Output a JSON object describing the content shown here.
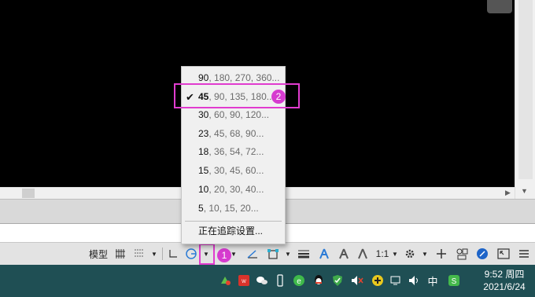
{
  "statusbar": {
    "model_label": "模型",
    "scale_label": "1:1"
  },
  "menu": {
    "items": [
      {
        "first": "90",
        "rest": ", 180, 270, 360...",
        "selected": false
      },
      {
        "first": "45",
        "rest": ", 90, 135, 180...",
        "selected": true
      },
      {
        "first": "30",
        "rest": ", 60, 90, 120...",
        "selected": false
      },
      {
        "first": "23",
        "rest": ", 45, 68, 90...",
        "selected": false
      },
      {
        "first": "18",
        "rest": ", 36, 54, 72...",
        "selected": false
      },
      {
        "first": "15",
        "rest": ", 30, 45, 60...",
        "selected": false
      },
      {
        "first": "10",
        "rest": ", 20, 30, 40...",
        "selected": false
      },
      {
        "first": "5",
        "rest": ", 10, 15, 20...",
        "selected": false
      }
    ],
    "check_mark": "✔",
    "settings_label": "正在追踪设置..."
  },
  "annotations": {
    "badge1": "1",
    "badge2": "2",
    "highlight_color": "#e13ccf"
  },
  "taskbar": {
    "ime_label": "中",
    "time": "9:52 周四",
    "date": "2021/6/24",
    "color": "#1f4f54"
  },
  "icons": [
    "grid-icon",
    "snap-icon",
    "ortho-icon",
    "polar-tracking-icon",
    "isodraft-icon",
    "object-snap-icon",
    "lineweight-icon",
    "annotation-scale-icon",
    "workspace-gear-icon",
    "plus-icon",
    "isolate-icon",
    "hardware-accel-icon",
    "fullscreen-icon",
    "menu-icon"
  ]
}
